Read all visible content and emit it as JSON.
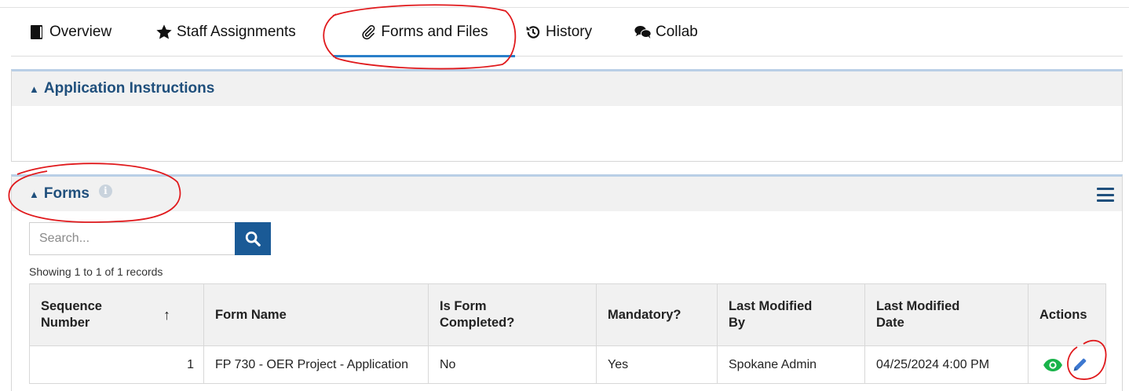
{
  "tabs": [
    {
      "label": "Overview",
      "icon": "book-icon",
      "active": false
    },
    {
      "label": "Staff Assignments",
      "icon": "star-icon",
      "active": false
    },
    {
      "label": "Forms and Files",
      "icon": "paperclip-icon",
      "active": true
    },
    {
      "label": "History",
      "icon": "history-icon",
      "active": false
    },
    {
      "label": "Collab",
      "icon": "chat-icon",
      "active": false
    }
  ],
  "instructions": {
    "title": "Application Instructions"
  },
  "forms": {
    "title": "Forms",
    "search_placeholder": "Search...",
    "records_text": "Showing 1 to 1 of 1 records",
    "columns": [
      "Sequence Number",
      "Form Name",
      "Is Form Completed?",
      "Mandatory?",
      "Last Modified By",
      "Last Modified Date",
      "Actions"
    ],
    "sort_indicator": "↑",
    "rows": [
      {
        "sequence": "1",
        "form_name": "FP 730 - OER Project - Application",
        "completed": "No",
        "mandatory": "Yes",
        "modified_by": "Spokane Admin",
        "modified_date": "04/25/2024 4:00 PM"
      }
    ]
  },
  "colors": {
    "accent": "#2a7fc9",
    "heading": "#1f4f7c",
    "search_button": "#1a5a96",
    "view_icon": "#19b34a",
    "edit_icon": "#3d78d0",
    "annotation": "#e0191c"
  }
}
